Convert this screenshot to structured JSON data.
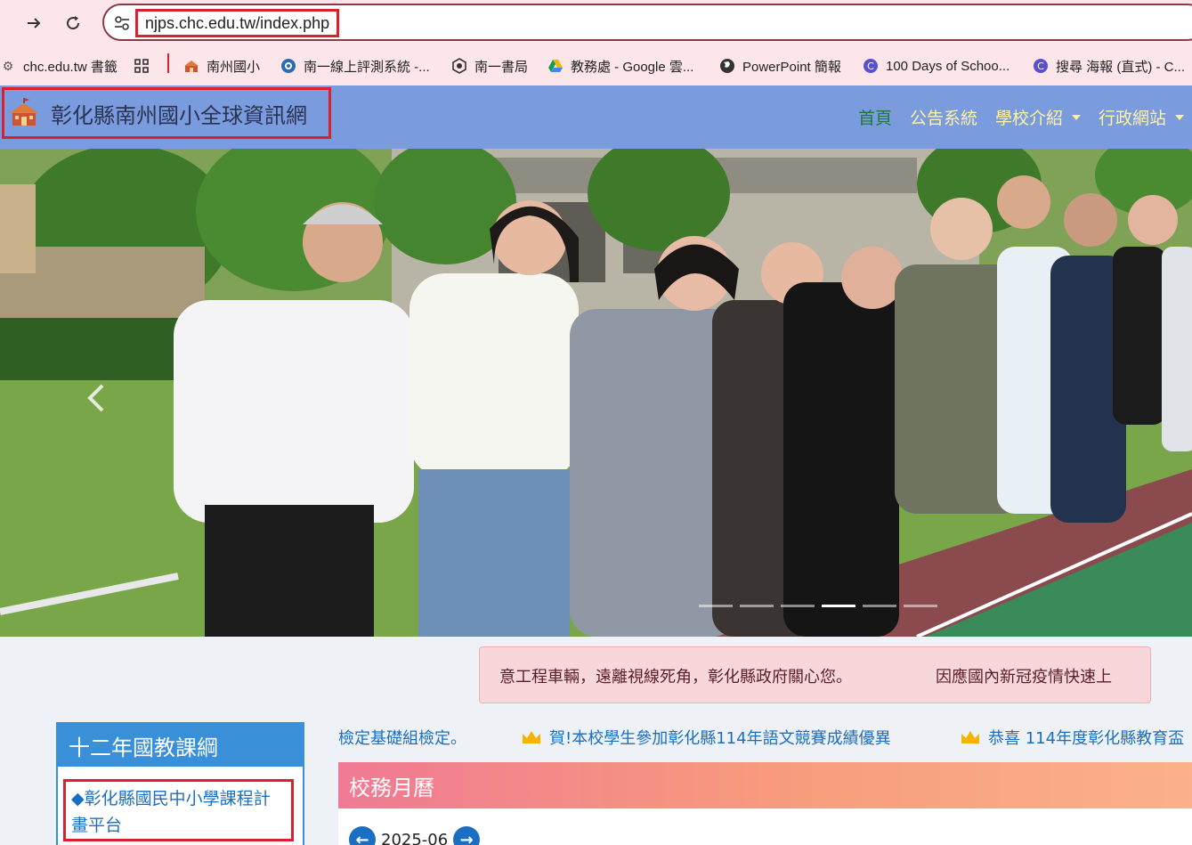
{
  "browser": {
    "url": "njps.chc.edu.tw/index.php",
    "bookmarks": [
      {
        "label": "chc.edu.tw 書籤",
        "icon": "gear-icon"
      },
      {
        "label": "",
        "icon": "apps-grid-icon"
      },
      {
        "label": "南州國小",
        "icon": "school-icon"
      },
      {
        "label": "南一線上評測系統 -...",
        "icon": "globe-icon"
      },
      {
        "label": "南一書局",
        "icon": "badge-icon"
      },
      {
        "label": "教務處 - Google 雲...",
        "icon": "google-drive-icon"
      },
      {
        "label": "PowerPoint 簡報",
        "icon": "earth-icon"
      },
      {
        "label": "100 Days of Schoo...",
        "icon": "canva-icon"
      },
      {
        "label": "搜尋 海報 (直式) - C...",
        "icon": "canva-icon"
      }
    ]
  },
  "site": {
    "brand": "彰化縣南州國小全球資訊網",
    "nav": [
      {
        "label": "首頁",
        "active": true,
        "dropdown": false
      },
      {
        "label": "公告系統",
        "active": false,
        "dropdown": false
      },
      {
        "label": "學校介紹",
        "active": false,
        "dropdown": true
      },
      {
        "label": "行政網站",
        "active": false,
        "dropdown": true
      }
    ],
    "nav_color": "#7b9bdf",
    "nav_text_color": "#fff4a0",
    "active_color": "#1d7a3a"
  },
  "hero": {
    "slide_count": 6,
    "active_slide": 4
  },
  "marquee": {
    "items": [
      "意工程車輛，遠離視線死角，彰化縣政府關心您。",
      "因應國內新冠疫情快速上"
    ]
  },
  "curriculum": {
    "title": "十二年國教課綱",
    "link": "◆彰化縣國民中小學課程計畫平台"
  },
  "ticker": {
    "lead": "檢定基礎組檢定。",
    "items": [
      "賀!本校學生參加彰化縣114年語文競賽成績優異",
      "恭喜 114年度彰化縣教育盃"
    ]
  },
  "calendar": {
    "title": "校務月曆",
    "month": "2025-06"
  }
}
